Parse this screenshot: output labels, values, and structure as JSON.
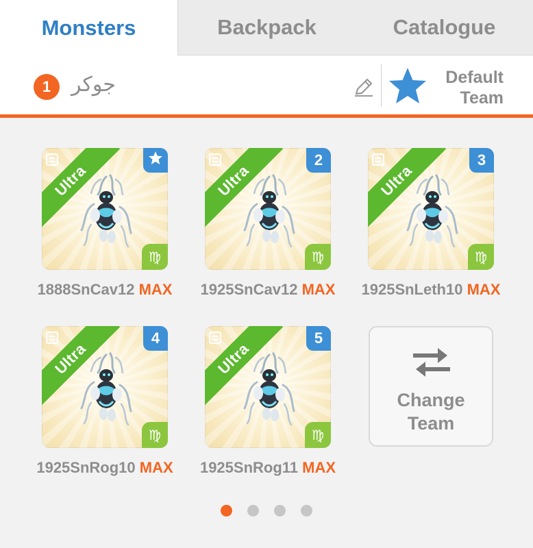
{
  "tabs": [
    {
      "label": "Monsters",
      "active": true
    },
    {
      "label": "Backpack",
      "active": false
    },
    {
      "label": "Catalogue",
      "active": false
    }
  ],
  "team": {
    "number": "1",
    "name": "جوكر",
    "default_button": {
      "line1": "Default",
      "line2": "Team"
    }
  },
  "monsters": [
    {
      "rarity": "Ultra",
      "slot": "",
      "slot_icon": "star-icon",
      "element_icon": "virgo-icon",
      "name": "1888SnCav12",
      "level": "MAX"
    },
    {
      "rarity": "Ultra",
      "slot": "2",
      "element_icon": "virgo-icon",
      "name": "1925SnCav12",
      "level": "MAX"
    },
    {
      "rarity": "Ultra",
      "slot": "3",
      "element_icon": "virgo-icon",
      "name": "1925SnLeth10",
      "level": "MAX"
    },
    {
      "rarity": "Ultra",
      "slot": "4",
      "element_icon": "virgo-icon",
      "name": "1925SnRog10",
      "level": "MAX"
    },
    {
      "rarity": "Ultra",
      "slot": "5",
      "element_icon": "virgo-icon",
      "name": "1925SnRog11",
      "level": "MAX"
    }
  ],
  "change_team": {
    "line1": "Change",
    "line2": "Team",
    "icon": "swap-arrows-icon"
  },
  "pagination": {
    "pages": 4,
    "current": 1
  },
  "colors": {
    "accent_orange": "#f26522",
    "tab_active_blue": "#2f7fc5",
    "badge_blue": "#3d8fd6",
    "rarity_green": "#5cb82f",
    "element_green": "#8cc63f",
    "muted_text": "#8d8d8d"
  }
}
